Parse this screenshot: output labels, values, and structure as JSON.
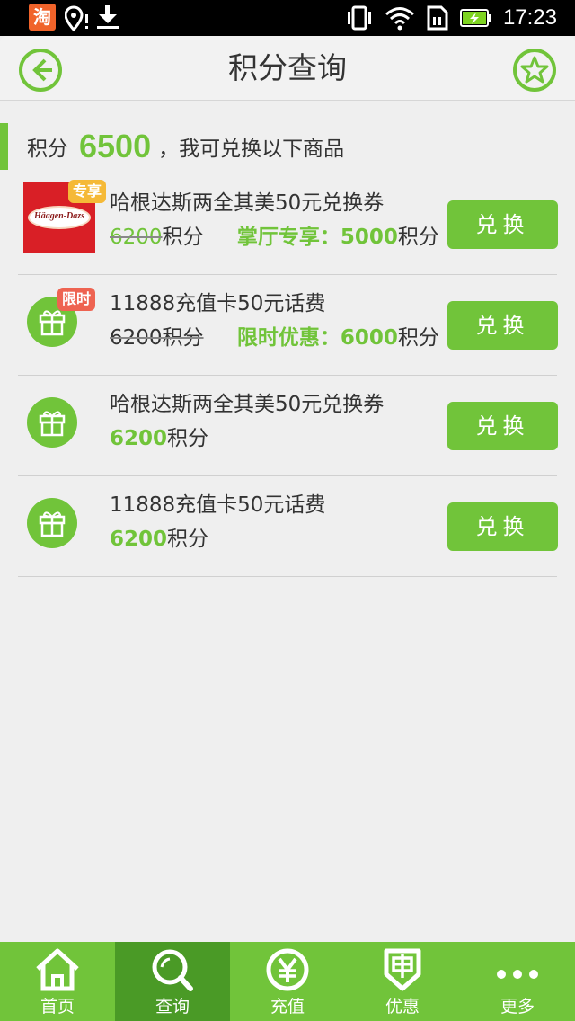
{
  "statusbar": {
    "time": "17:23",
    "app_badge": "淘"
  },
  "header": {
    "title": "积分查询"
  },
  "summary": {
    "prefix": "积分",
    "points": "6500",
    "suffix": "，我可兑换以下商品"
  },
  "items": [
    {
      "title": "哈根达斯两全其美50元兑换券",
      "orig_points": "6200",
      "unit": "积分",
      "promo_label": "掌厅专享：",
      "promo_points": "5000",
      "badge": "专享",
      "button": "兑换",
      "logo_text": "Häagen-Dazs"
    },
    {
      "title": "11888充值卡50元话费",
      "orig_points": "6200",
      "unit": "积分",
      "promo_label": "限时优惠：",
      "promo_points": "6000",
      "badge": "限时",
      "button": "兑换"
    },
    {
      "title": "哈根达斯两全其美50元兑换券",
      "points": "6200",
      "unit": "积分",
      "button": "兑换"
    },
    {
      "title": "11888充值卡50元话费",
      "points": "6200",
      "unit": "积分",
      "button": "兑换"
    }
  ],
  "tabs": [
    {
      "label": "首页",
      "icon": "home-icon"
    },
    {
      "label": "查询",
      "icon": "search-icon",
      "active": true
    },
    {
      "label": "充值",
      "icon": "yuan-icon"
    },
    {
      "label": "优惠",
      "icon": "coupon-icon"
    },
    {
      "label": "更多",
      "icon": "more-icon"
    }
  ],
  "colors": {
    "accent": "#71c43a",
    "accent_dark": "#4a9a26",
    "badge_yellow": "#f5b937",
    "badge_red": "#ee6351"
  }
}
